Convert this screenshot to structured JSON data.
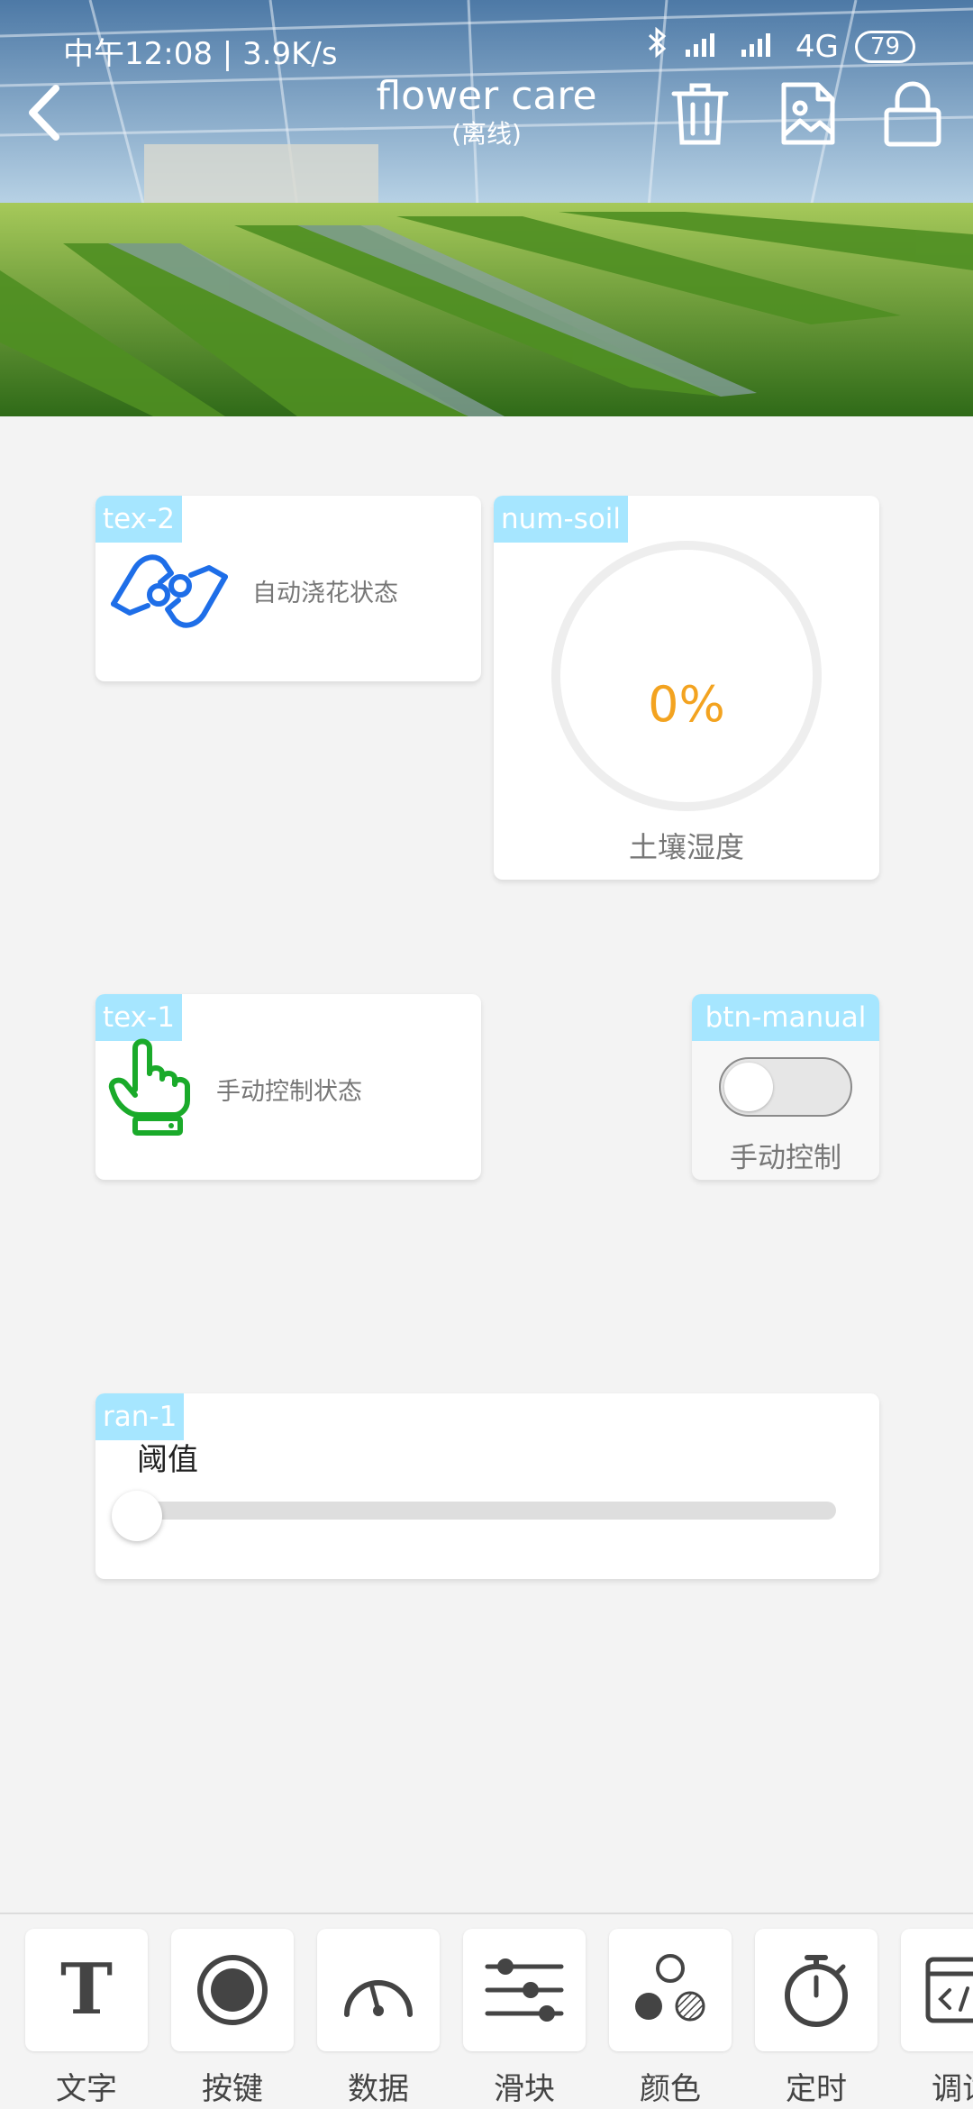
{
  "status_bar": {
    "time": "中午12:08",
    "speed": "3.9K/s",
    "network": "4G",
    "battery": "79"
  },
  "header": {
    "title": "flower care",
    "subtitle": "(离线)"
  },
  "widgets": {
    "tex2": {
      "tag": "tex-2",
      "label": "自动浇花状态",
      "icon": "hands-icon",
      "icon_color": "#1e6ee8"
    },
    "num_soil": {
      "tag": "num-soil",
      "value": "0%",
      "label": "土壤湿度",
      "value_color": "#f3a320",
      "fraction": 0
    },
    "tex1": {
      "tag": "tex-1",
      "label": "手动控制状态",
      "icon": "pointing-hand-icon",
      "icon_color": "#1aaa2a"
    },
    "btn_manual": {
      "tag": "btn-manual",
      "label": "手动控制",
      "on": false
    },
    "ran1": {
      "tag": "ran-1",
      "label": "阈值",
      "fraction": 0
    }
  },
  "toolbar": {
    "items": [
      {
        "label": "文字",
        "icon": "text-icon"
      },
      {
        "label": "按键",
        "icon": "button-icon"
      },
      {
        "label": "数据",
        "icon": "gauge-icon"
      },
      {
        "label": "滑块",
        "icon": "slider-icon"
      },
      {
        "label": "颜色",
        "icon": "color-icon"
      },
      {
        "label": "定时",
        "icon": "timer-icon"
      },
      {
        "label": "调试",
        "icon": "debug-icon"
      }
    ]
  },
  "colors": {
    "tag_bg": "#a6e6ff",
    "page_bg": "#f3f3f3"
  }
}
